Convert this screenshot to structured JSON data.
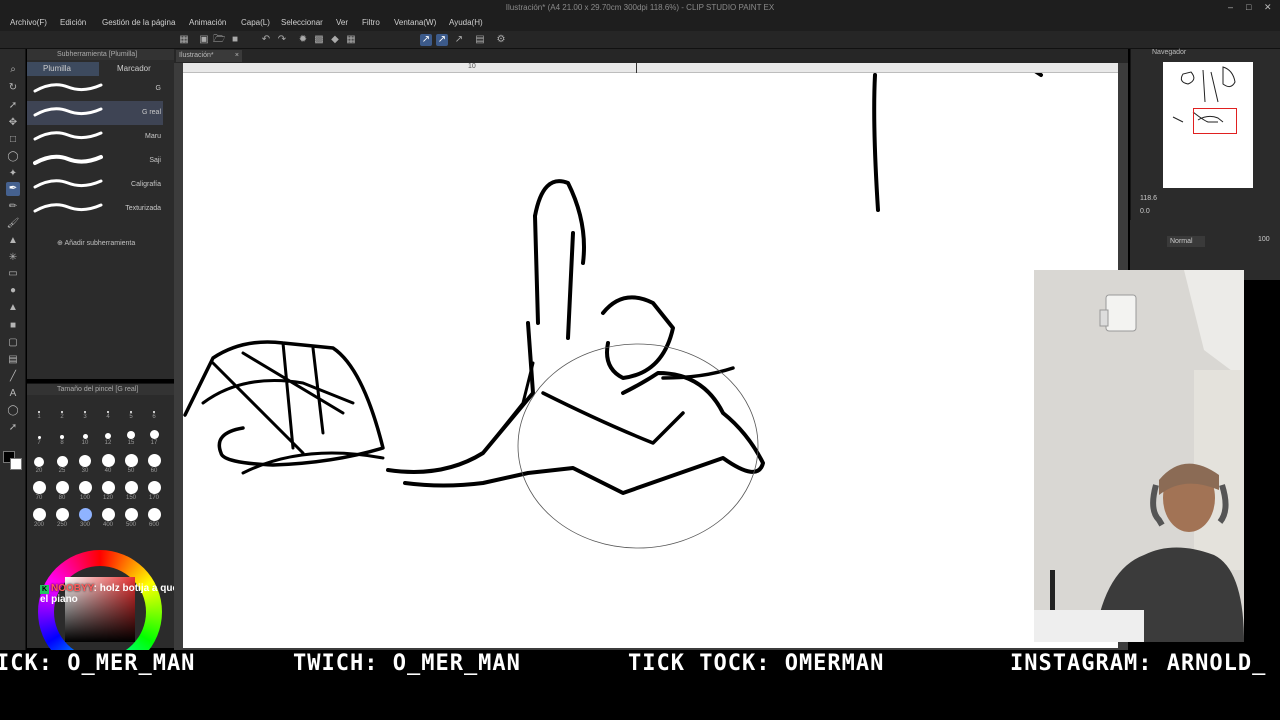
{
  "window": {
    "title": "Ilustración* (A4 21.00 x 29.70cm 300dpi 118.6%)  - CLIP STUDIO PAINT EX"
  },
  "menu": [
    "Archivo(F)",
    "Edición",
    "Gestión de la página",
    "Animación",
    "Capa(L)",
    "Seleccionar",
    "Ver",
    "Filtro",
    "Ventana(W)",
    "Ayuda(H)"
  ],
  "subtool_panel": {
    "header": "Subherramienta [Plumilla]",
    "tabs": [
      "Plumilla",
      "Marcador"
    ],
    "brushes": [
      "G",
      "G real",
      "Maru",
      "Saji",
      "Caligrafía",
      "Texturizada"
    ],
    "selected_brush": "G real",
    "add_label": "Añadir subherramienta"
  },
  "brush_size_panel": {
    "header": "Tamaño del pincel [G real]",
    "sizes": [
      "1",
      "2",
      "3",
      "4",
      "5",
      "6",
      "7",
      "8",
      "10",
      "12",
      "15",
      "17",
      "20",
      "25",
      "30",
      "40",
      "50",
      "60",
      "70",
      "80",
      "100",
      "120",
      "150",
      "170",
      "200",
      "250",
      "300",
      "400",
      "500",
      "600"
    ],
    "selected_size": "300"
  },
  "document": {
    "tab_label": "Ilustración*",
    "ruler_mark": "10"
  },
  "navigator": {
    "header": "Navegador",
    "zoom": "118.6",
    "rotation": "0.0"
  },
  "layer": {
    "blend_mode": "Normal",
    "opacity": "100"
  },
  "chat": {
    "user": "NOOBYY",
    "message": ": holz botija a que hora tocas el piano"
  },
  "banner": {
    "items": [
      "ICK: O_MER_MAN",
      "TWICH: O_MER_MAN",
      "TICK TOCK: OMERMAN",
      "INSTAGRAM: ARNOLD_"
    ]
  },
  "colors": {
    "ui_dark": "#2b2b2b",
    "accent": "#45618f",
    "canvas": "#ffffff",
    "banner_text": "#ffffff"
  }
}
